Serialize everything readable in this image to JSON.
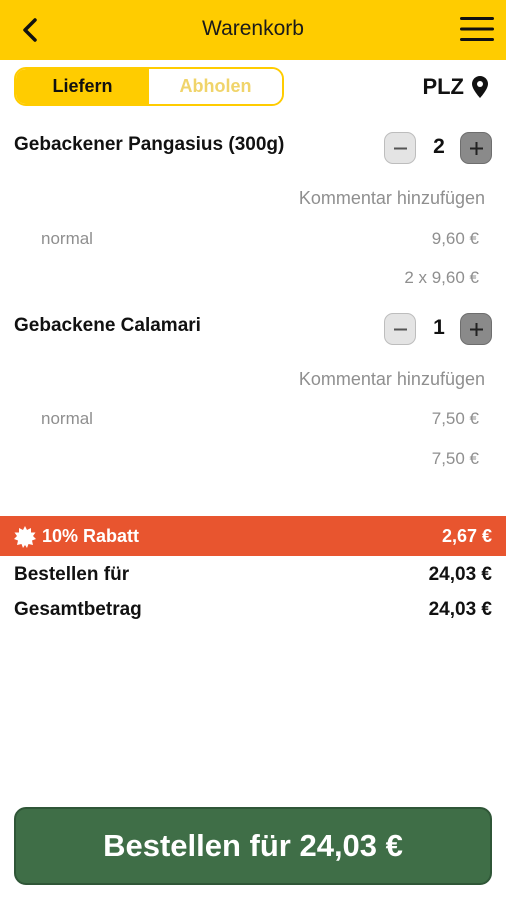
{
  "header": {
    "title": "Warenkorb",
    "back_icon": "chevron-left-icon",
    "menu_icon": "hamburger-menu-icon"
  },
  "delivery_toggle": {
    "options": [
      "Liefern",
      "Abholen"
    ],
    "selected": "Liefern"
  },
  "location": {
    "label": "PLZ",
    "icon": "location-pin-icon"
  },
  "cart": {
    "items": [
      {
        "name": "Gebackener Pangasius (300g)",
        "quantity": "2",
        "comment_label": "Kommentar hinzufügen",
        "variant": "normal",
        "unit_price": "9,60 €",
        "line_total": "2 x 9,60 €"
      },
      {
        "name": "Gebackene Calamari",
        "quantity": "1",
        "comment_label": "Kommentar hinzufügen",
        "variant": "normal",
        "unit_price": "7,50 €",
        "line_total": "7,50 €"
      }
    ]
  },
  "discount": {
    "label": "10% Rabatt",
    "value": "2,67 €",
    "icon": "badge-burst-icon"
  },
  "summary": {
    "order_for_label": "Bestellen für",
    "order_for_value": "24,03 €",
    "total_label": "Gesamtbetrag",
    "total_value": "24,03 €"
  },
  "order_button": {
    "label": "Bestellen für 24,03 €"
  },
  "colors": {
    "accent": "#FFCC00",
    "discount_bar": "#E8552F",
    "order_button": "#3F6E47"
  }
}
